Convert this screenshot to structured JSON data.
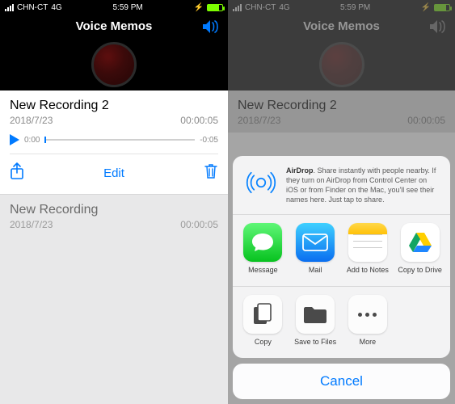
{
  "status": {
    "carrier": "CHN-CT",
    "net": "4G",
    "time": "5:59 PM"
  },
  "header": {
    "title": "Voice Memos"
  },
  "rec1": {
    "title": "New Recording 2",
    "date": "2018/7/23",
    "len": "00:00:05",
    "elapsed": "0:00",
    "remaining": "-0:05",
    "edit": "Edit"
  },
  "rec2": {
    "title": "New Recording",
    "date": "2018/7/23",
    "len": "00:00:05"
  },
  "share": {
    "airdrop_label": "AirDrop",
    "airdrop_body": ". Share instantly with people nearby. If they turn on AirDrop from Control Center on iOS or from Finder on the Mac, you'll see their names here. Just tap to share.",
    "apps": {
      "message": "Message",
      "mail": "Mail",
      "notes": "Add to Notes",
      "drive": "Copy to Drive"
    },
    "actions": {
      "copy": "Copy",
      "save": "Save to Files",
      "more": "More"
    },
    "cancel": "Cancel"
  }
}
